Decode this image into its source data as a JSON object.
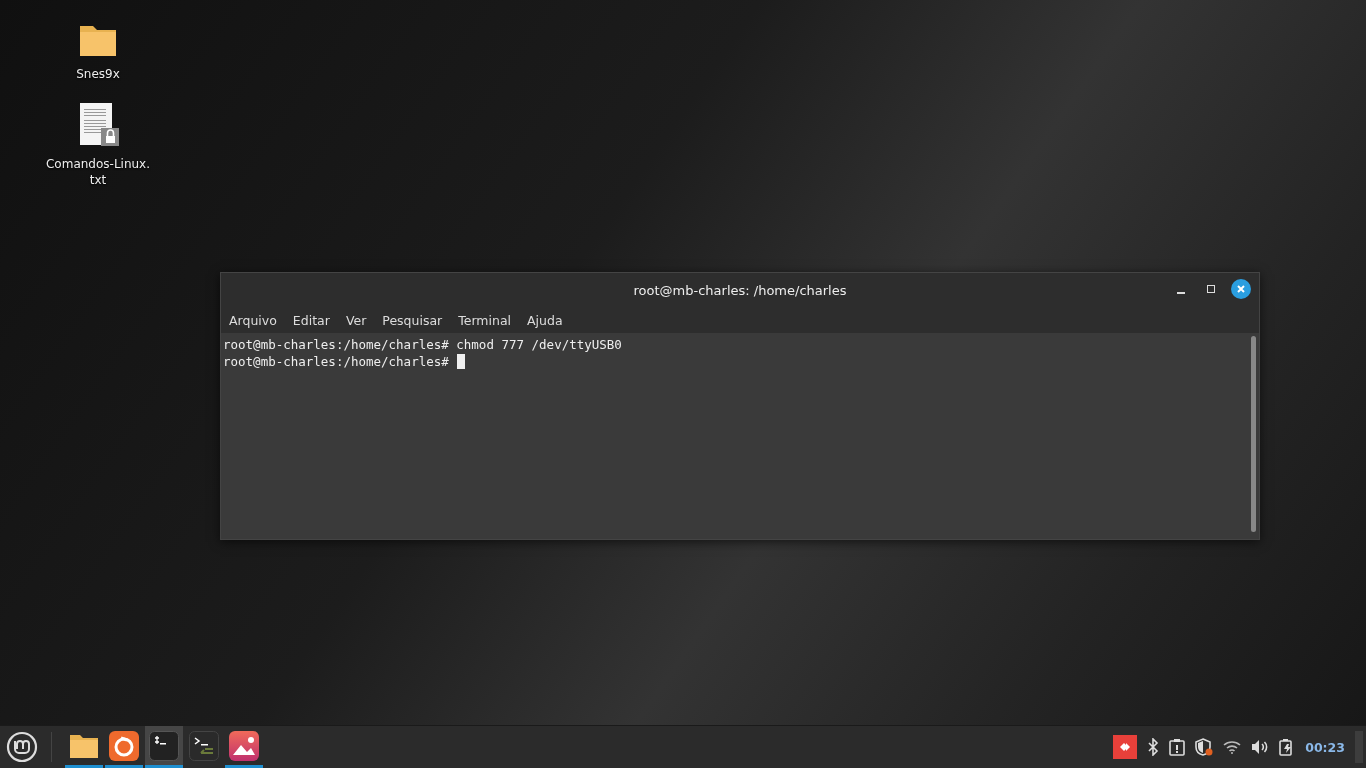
{
  "desktop_icons": [
    {
      "kind": "folder",
      "label": "Snes9x"
    },
    {
      "kind": "text-file",
      "label": "Comandos-Linux.\ntxt"
    }
  ],
  "window": {
    "title": "root@mb-charles: /home/charles",
    "menu": [
      "Arquivo",
      "Editar",
      "Ver",
      "Pesquisar",
      "Terminal",
      "Ajuda"
    ],
    "lines": [
      {
        "prompt": "root@mb-charles:/home/charles#",
        "command": "chmod 777 /dev/ttyUSB0"
      },
      {
        "prompt": "root@mb-charles:/home/charles#"
      }
    ]
  },
  "taskbar": {
    "apps": [
      {
        "kind": "files",
        "running": true,
        "selected": false
      },
      {
        "kind": "browser",
        "running": true,
        "selected": false
      },
      {
        "kind": "terminal",
        "running": true,
        "selected": true
      },
      {
        "kind": "terminal-alt",
        "running": false,
        "selected": false
      },
      {
        "kind": "image-viewer",
        "running": true,
        "selected": false
      }
    ],
    "clock": "00:23"
  }
}
